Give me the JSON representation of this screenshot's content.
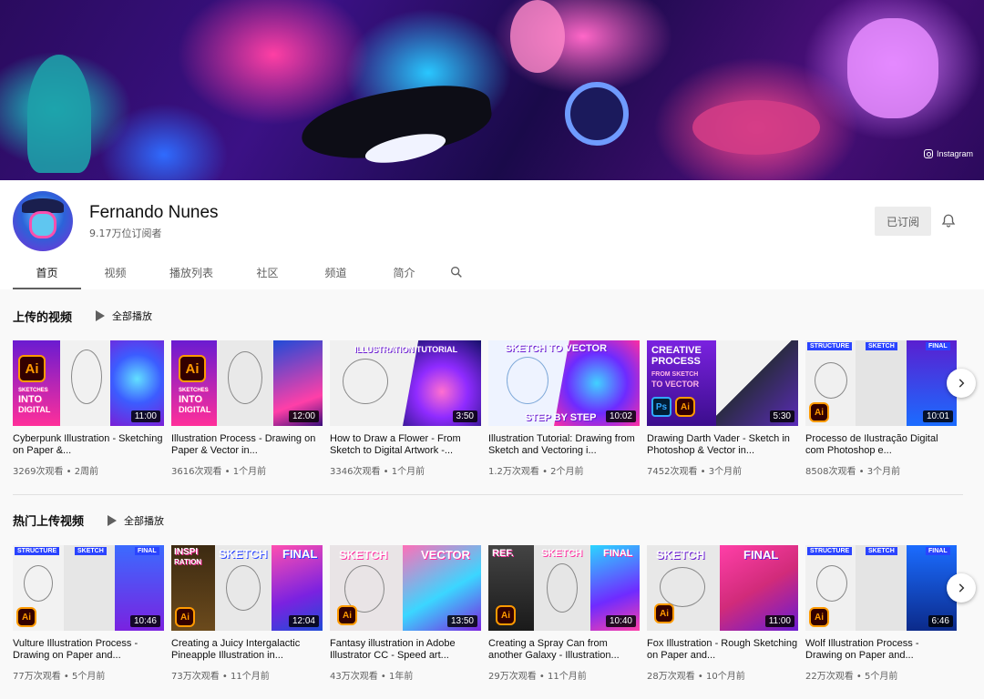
{
  "banner": {
    "instagram_label": "Instagram"
  },
  "channel": {
    "name": "Fernando Nunes",
    "subscribers": "9.17万位订阅者",
    "subscribed_label": "已订阅"
  },
  "tabs": [
    {
      "label": "首页",
      "active": true
    },
    {
      "label": "视频"
    },
    {
      "label": "播放列表"
    },
    {
      "label": "社区"
    },
    {
      "label": "频道"
    },
    {
      "label": "简介"
    }
  ],
  "sections": [
    {
      "title": "上传的视频",
      "play_all": "全部播放",
      "videos": [
        {
          "title": "Cyberpunk Illustration - Sketching on Paper &...",
          "views": "3269次观看",
          "age": "2周前",
          "duration": "11:00",
          "thumb_text": [
            "SKETCHES",
            "INTO",
            "DIGITAL"
          ],
          "badge": "Ai"
        },
        {
          "title": "Illustration Process - Drawing on Paper & Vector in...",
          "views": "3616次观看",
          "age": "1个月前",
          "duration": "12:00",
          "thumb_text": [
            "SKETCHES",
            "INTO",
            "DIGITAL"
          ],
          "badge": "Ai"
        },
        {
          "title": "How to Draw a Flower - From Sketch to Digital Artwork -...",
          "views": "3346次观看",
          "age": "1个月前",
          "duration": "3:50",
          "thumb_text": [
            "ILLUSTRATION TUTORIAL"
          ]
        },
        {
          "title": "Illustration Tutorial: Drawing from Sketch and Vectoring i...",
          "views": "1.2万次观看",
          "age": "2个月前",
          "duration": "10:02",
          "thumb_text": [
            "SKETCH TO VECTOR",
            "STEP BY STEP"
          ]
        },
        {
          "title": "Drawing Darth Vader - Sketch in Photoshop & Vector in...",
          "views": "7452次观看",
          "age": "3个月前",
          "duration": "5:30",
          "thumb_text": [
            "CREATIVE",
            "PROCESS",
            "FROM SKETCH",
            "TO VECTOR"
          ],
          "badge": "Ai",
          "badge2": "Ps"
        },
        {
          "title": "Processo de Ilustração Digital com Photoshop e...",
          "views": "8508次观看",
          "age": "3个月前",
          "duration": "10:01",
          "thumb_text": [
            "STRUCTURE",
            "SKETCH",
            "FINAL"
          ],
          "badge": "Ai"
        }
      ]
    },
    {
      "title": "热门上传视频",
      "play_all": "全部播放",
      "videos": [
        {
          "title": "Vulture Illustration Process - Drawing on Paper and...",
          "views": "77万次观看",
          "age": "5个月前",
          "duration": "10:46",
          "thumb_text": [
            "STRUCTURE",
            "SKETCH",
            "FINAL"
          ],
          "badge": "Ai"
        },
        {
          "title": "Creating a Juicy Intergalactic Pineapple Illustration in...",
          "views": "73万次观看",
          "age": "11个月前",
          "duration": "12:04",
          "thumb_text": [
            "INSPI",
            "RATION",
            "SKETCH",
            "FINAL"
          ],
          "badge": "Ai"
        },
        {
          "title": "Fantasy illustration in Adobe Illustrator CC - Speed art...",
          "views": "43万次观看",
          "age": "1年前",
          "duration": "13:50",
          "thumb_text": [
            "SKETCH",
            "VECTOR"
          ],
          "badge": "Ai"
        },
        {
          "title": "Creating a Spray Can from another Galaxy - Illustration...",
          "views": "29万次观看",
          "age": "11个月前",
          "duration": "10:40",
          "thumb_text": [
            "REF.",
            "SKETCH",
            "FINAL"
          ],
          "badge": "Ai"
        },
        {
          "title": "Fox Illustration - Rough Sketching on Paper and...",
          "views": "28万次观看",
          "age": "10个月前",
          "duration": "11:00",
          "thumb_text": [
            "SKETCH",
            "FINAL"
          ],
          "badge": "Ai"
        },
        {
          "title": "Wolf Illustration Process - Drawing on Paper and...",
          "views": "22万次观看",
          "age": "5个月前",
          "duration": "6:46",
          "thumb_text": [
            "STRUCTURE",
            "SKETCH",
            "FINAL"
          ],
          "badge": "Ai"
        }
      ]
    }
  ],
  "meta_separator": " • ",
  "icons": {
    "search": "search-icon",
    "bell": "bell-icon",
    "next": "chevron-right-icon",
    "play": "play-icon"
  }
}
